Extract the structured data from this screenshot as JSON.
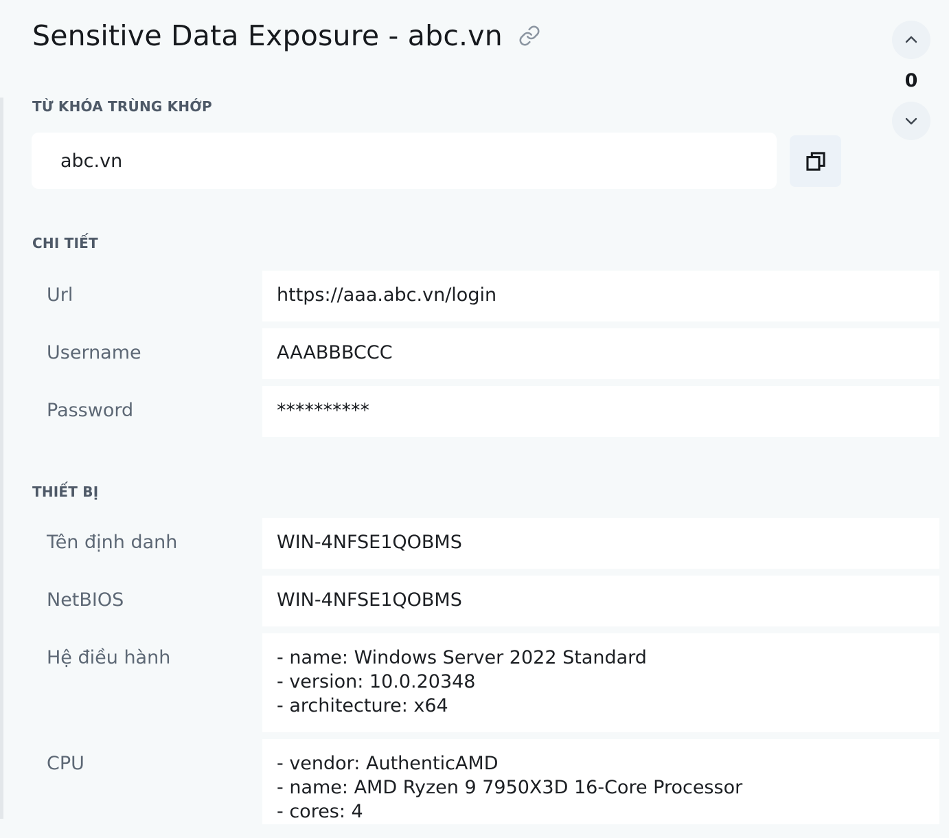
{
  "header": {
    "title": "Sensitive Data Exposure - abc.vn",
    "link_icon": "link-icon"
  },
  "navigator": {
    "count": "0",
    "up_icon": "chevron-up-icon",
    "down_icon": "chevron-down-icon"
  },
  "keyword_section": {
    "label": "TỪ KHÓA TRÙNG KHỚP",
    "value": "abc.vn",
    "copy_icon": "copy-icon"
  },
  "details_section": {
    "label": "CHI TIẾT",
    "rows": [
      {
        "label": "Url",
        "value": "https://aaa.abc.vn/login"
      },
      {
        "label": "Username",
        "value": "AAABBBCCC"
      },
      {
        "label": "Password",
        "value": "**********"
      }
    ]
  },
  "device_section": {
    "label": "THIẾT BỊ",
    "rows": [
      {
        "label": "Tên định danh",
        "lines": [
          "WIN-4NFSE1QOBMS"
        ]
      },
      {
        "label": "NetBIOS",
        "lines": [
          "WIN-4NFSE1QOBMS"
        ]
      },
      {
        "label": "Hệ điều hành",
        "lines": [
          "- name: Windows Server 2022 Standard",
          "- version: 10.0.20348",
          "- architecture: x64"
        ]
      },
      {
        "label": "CPU",
        "lines": [
          "- vendor: AuthenticAMD",
          "- name: AMD Ryzen 9 7950X3D 16-Core Processor",
          "- cores: 4"
        ]
      }
    ]
  },
  "colors": {
    "background": "#f6f9fa",
    "card": "#ffffff",
    "section_label": "#4e5967",
    "row_label": "#5d6875",
    "button_bg": "#ecf2f8"
  }
}
